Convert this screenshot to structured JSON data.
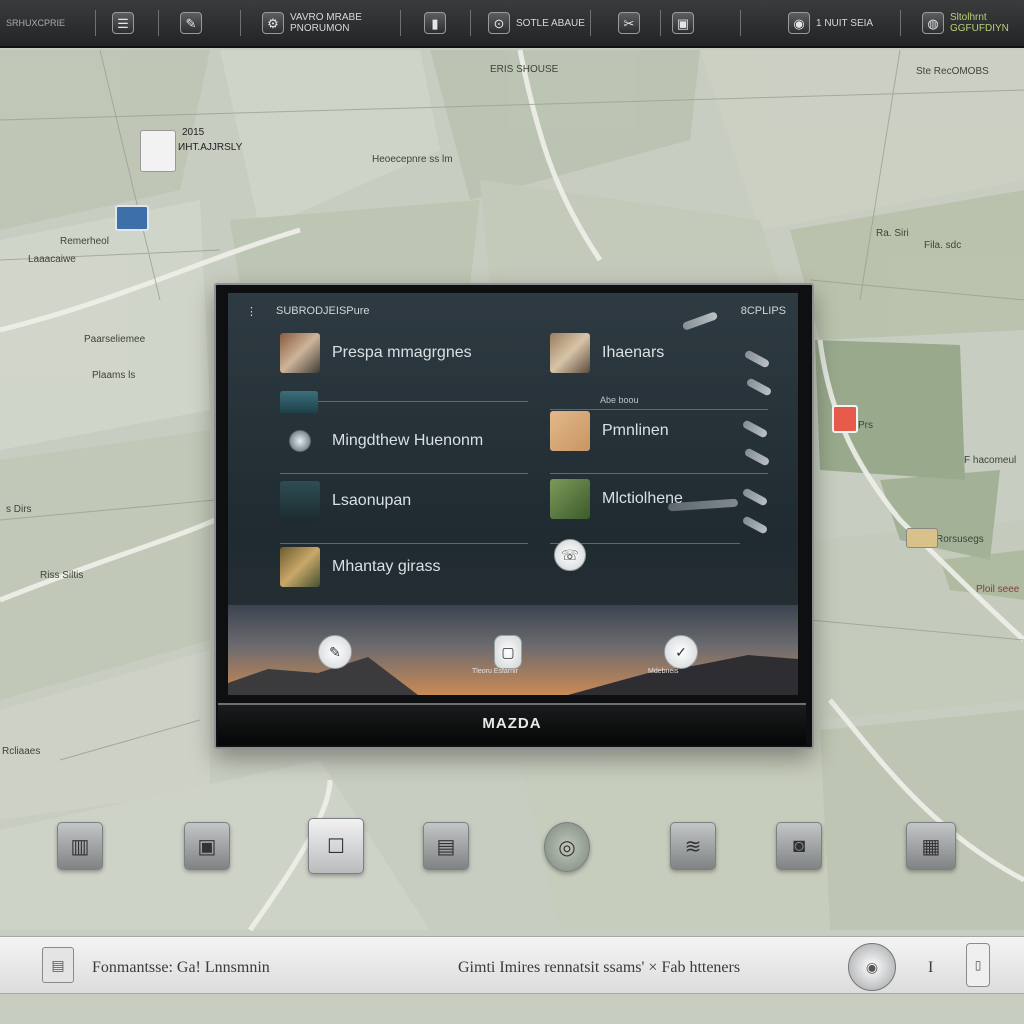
{
  "topbar": {
    "items": [
      {
        "icon": "list-icon",
        "glyph": "☰",
        "label": ""
      },
      {
        "icon": "camera-icon",
        "glyph": "✎",
        "label": ""
      },
      {
        "icon": "signal-icon",
        "glyph": "⚙",
        "label": "VAVRO MRABE\nPNORUMON"
      },
      {
        "icon": "battery-icon",
        "glyph": "▮",
        "label": ""
      },
      {
        "icon": "car-icon",
        "glyph": "⊙",
        "label": "SOTLE ABAUE"
      },
      {
        "icon": "tools-icon",
        "glyph": "✂",
        "label": ""
      },
      {
        "icon": "photo-icon",
        "glyph": "▣",
        "label": ""
      },
      {
        "icon": "disc-icon",
        "glyph": "◉",
        "label": "1 NUIT SEIA"
      },
      {
        "icon": "globe-icon",
        "glyph": "◍",
        "label": "Sltolhrnt\nGGFUFDIYN"
      }
    ],
    "left_text": "SRHUXCPRIE"
  },
  "map": {
    "labels": [
      "ERIS SHOUSE",
      "2015",
      "ИНТ.AJJRSLY",
      "Heoecepnre ss lm",
      "Ste RecOMOBS",
      "Laaacaiwe",
      "Paarseliemee",
      "Plaams ls",
      "Ra. Siri",
      "Fila. sdc",
      "Prs",
      "F hacomeul",
      "Rorsusegs",
      "Ploil seee",
      "s Dirs",
      "Riss Siltis",
      "Rcliaaes",
      "Remerheol"
    ]
  },
  "screen": {
    "title": "SUBRODJEISPure",
    "right_label": "8CPLIPS",
    "rows_left": [
      {
        "label": "Prespa mmagrgnes"
      },
      {
        "label": "Mingdthew Huenonm"
      },
      {
        "label": "Lsaonupan"
      },
      {
        "label": "Mhantay girass"
      }
    ],
    "rows_right": [
      {
        "label": "Ihaenars"
      },
      {
        "label": "Pmnlinen"
      },
      {
        "label": "Mlctiolhene"
      }
    ],
    "sub_label": "Abe boou",
    "bottom_captions": [
      "",
      "Tleoru Esfarnir",
      "Mdebneis"
    ],
    "brand": "MAZDA"
  },
  "bottombar": {
    "left_text": "Fonmantsse: Ga!  Lnnsmnin",
    "right_text": "Gimti Imires rennatsit ssams' × Fab htteners",
    "separator": "I"
  }
}
